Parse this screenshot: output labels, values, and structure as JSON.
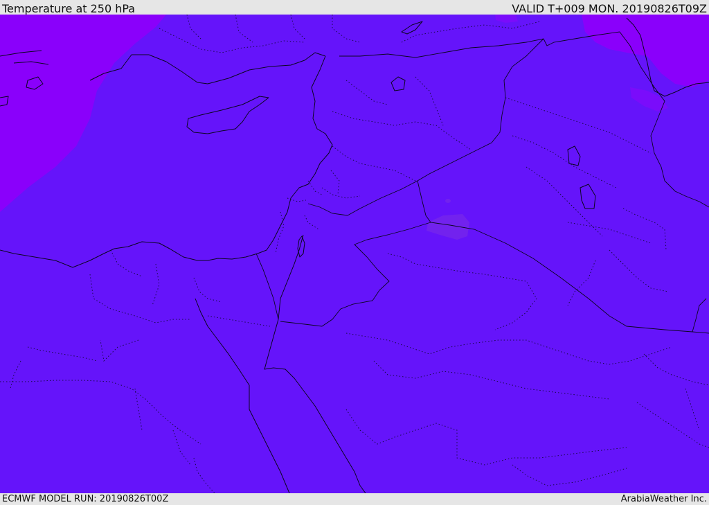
{
  "header": {
    "title": "Temperature at 250 hPa",
    "valid": "VALID T+009 MON. 20190826T09Z"
  },
  "footer": {
    "model_run": "ECMWF MODEL RUN: 20190826T00Z",
    "credit": "ArabiaWeather Inc."
  },
  "colors": {
    "base_field": "#6514fa",
    "warm_field": "#8a00fb",
    "mid_field": "#7a0cfb",
    "patch_field": "#7222ee",
    "frame": "#e6e6e6",
    "boundary": "#0b0620"
  }
}
